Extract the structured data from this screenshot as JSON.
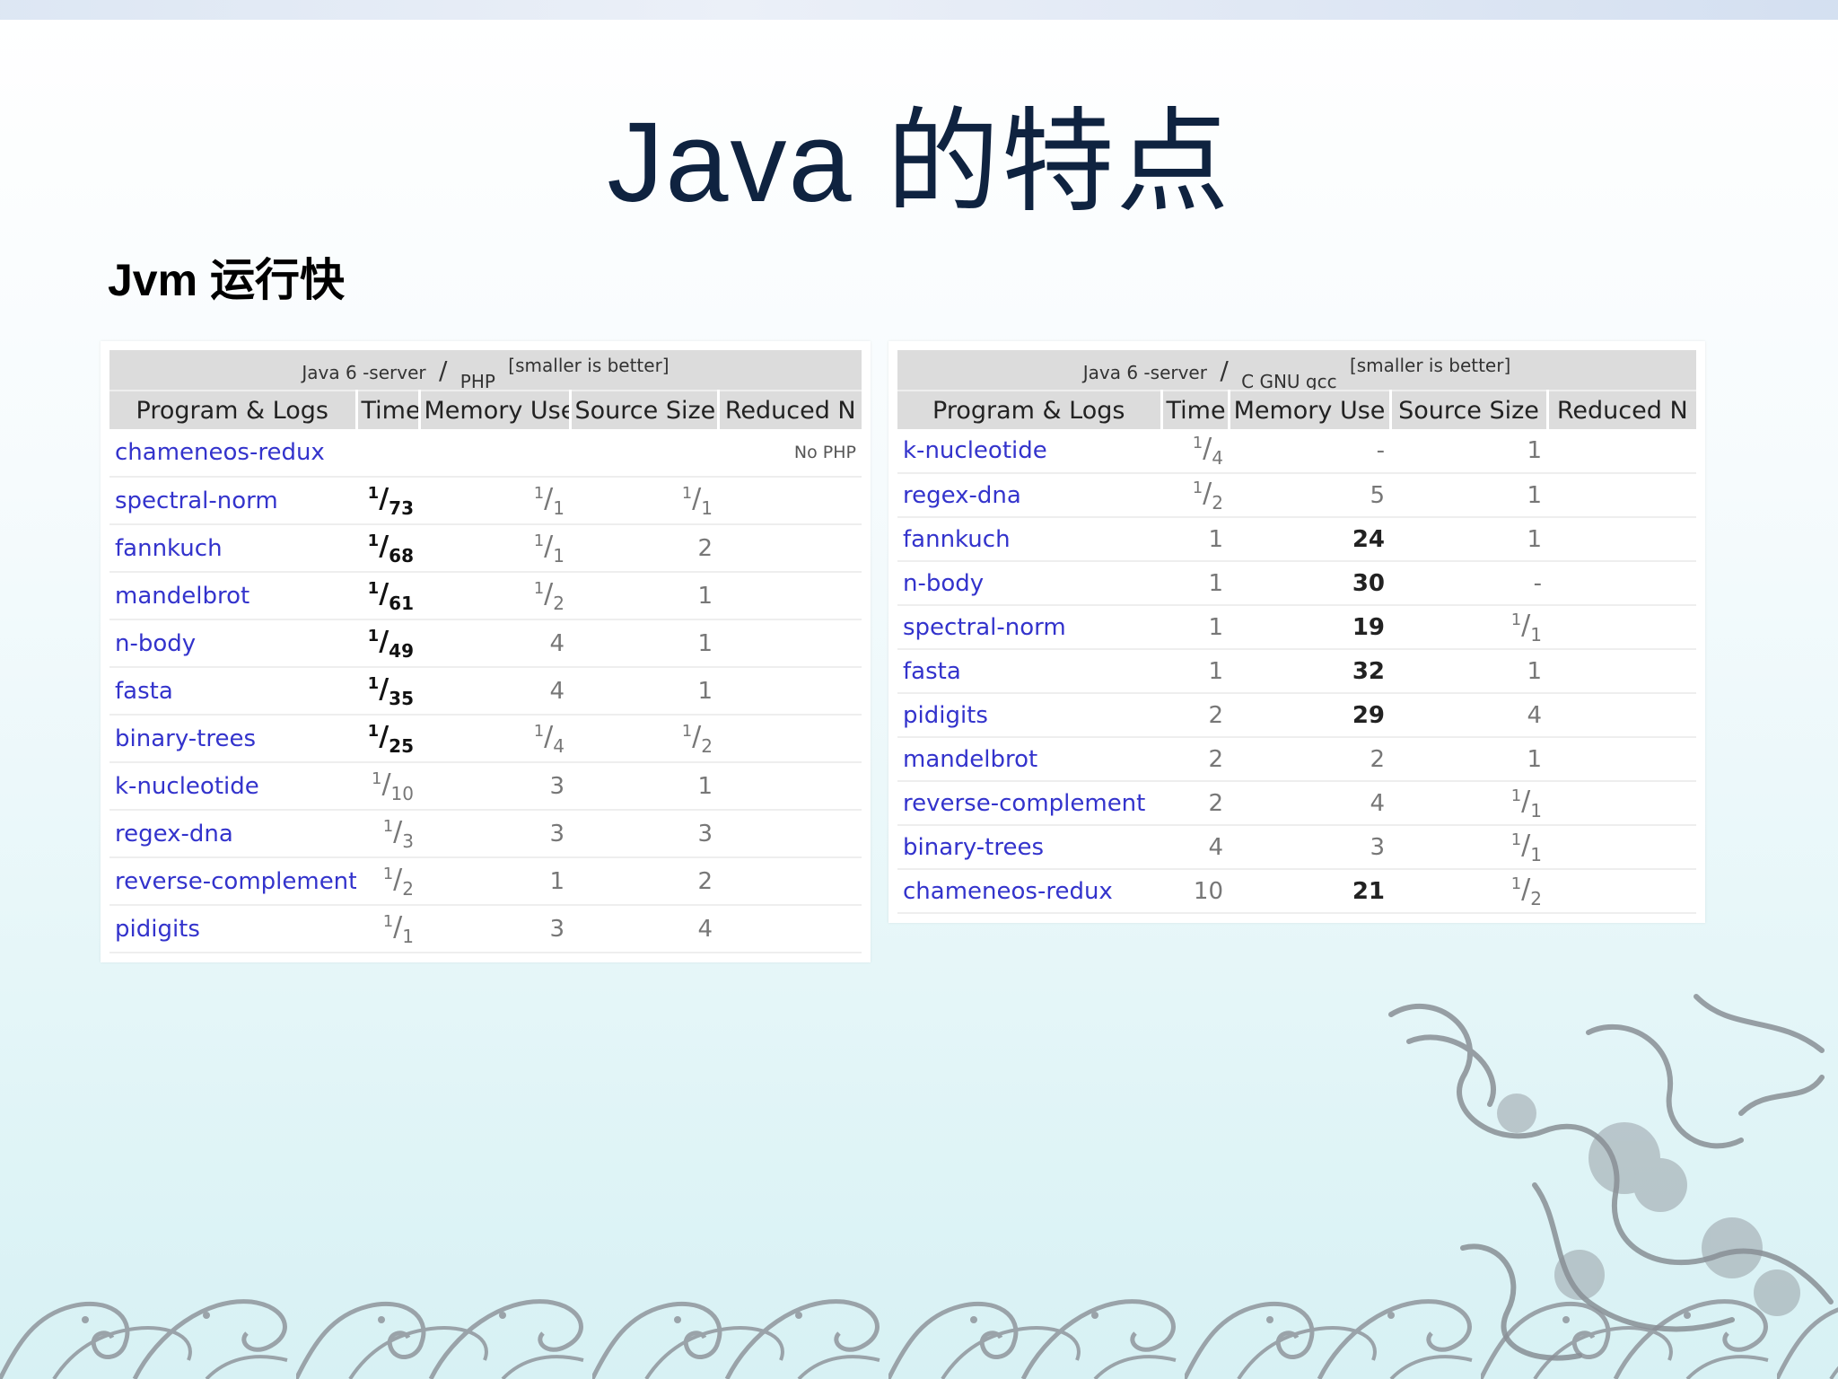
{
  "slide": {
    "title": "Java 的特点",
    "subtitle": "Jvm 运行快"
  },
  "table_left": {
    "caption": {
      "left": "Java 6 -server",
      "slash": "/",
      "right": "PHP",
      "note": "[smaller is better]"
    },
    "headers": [
      "Program & Logs",
      "Time",
      "Memory Use",
      "Source Size",
      "Reduced N"
    ],
    "rows": [
      {
        "program": "chameneos-redux",
        "note": "No PHP"
      },
      {
        "program": "spectral-norm",
        "time": {
          "num": "1",
          "den": "73",
          "bold": true
        },
        "memory": {
          "num": "1",
          "den": "1"
        },
        "source": {
          "num": "1",
          "den": "1"
        }
      },
      {
        "program": "fannkuch",
        "time": {
          "num": "1",
          "den": "68",
          "bold": true
        },
        "memory": {
          "num": "1",
          "den": "1"
        },
        "source": "2"
      },
      {
        "program": "mandelbrot",
        "time": {
          "num": "1",
          "den": "61",
          "bold": true
        },
        "memory": {
          "num": "1",
          "den": "2"
        },
        "source": "1"
      },
      {
        "program": "n-body",
        "time": {
          "num": "1",
          "den": "49",
          "bold": true
        },
        "memory": "4",
        "source": "1"
      },
      {
        "program": "fasta",
        "time": {
          "num": "1",
          "den": "35",
          "bold": true
        },
        "memory": "4",
        "source": "1"
      },
      {
        "program": "binary-trees",
        "time": {
          "num": "1",
          "den": "25",
          "bold": true
        },
        "memory": {
          "num": "1",
          "den": "4"
        },
        "source": {
          "num": "1",
          "den": "2"
        }
      },
      {
        "program": "k-nucleotide",
        "time": {
          "num": "1",
          "den": "10"
        },
        "memory": "3",
        "source": "1"
      },
      {
        "program": "regex-dna",
        "time": {
          "num": "1",
          "den": "3"
        },
        "memory": "3",
        "source": "3"
      },
      {
        "program": "reverse-complement",
        "time": {
          "num": "1",
          "den": "2"
        },
        "memory": "1",
        "source": "2"
      },
      {
        "program": "pidigits",
        "time": {
          "num": "1",
          "den": "1"
        },
        "memory": "3",
        "source": "4"
      }
    ]
  },
  "table_right": {
    "caption": {
      "left": "Java 6 -server",
      "slash": "/",
      "right": "C GNU gcc",
      "note": "[smaller is better]"
    },
    "headers": [
      "Program & Logs",
      "Time",
      "Memory Use",
      "Source Size",
      "Reduced N"
    ],
    "rows": [
      {
        "program": "k-nucleotide",
        "time": {
          "num": "1",
          "den": "4"
        },
        "memory": "-",
        "source": "1"
      },
      {
        "program": "regex-dna",
        "time": {
          "num": "1",
          "den": "2"
        },
        "memory": "5",
        "source": "1"
      },
      {
        "program": "fannkuch",
        "time": "1",
        "memory": "24",
        "memory_bold": true,
        "source": "1"
      },
      {
        "program": "n-body",
        "time": "1",
        "memory": "30",
        "memory_bold": true,
        "source": "-"
      },
      {
        "program": "spectral-norm",
        "time": "1",
        "memory": "19",
        "memory_bold": true,
        "source": {
          "num": "1",
          "den": "1"
        }
      },
      {
        "program": "fasta",
        "time": "1",
        "memory": "32",
        "memory_bold": true,
        "source": "1"
      },
      {
        "program": "pidigits",
        "time": "2",
        "memory": "29",
        "memory_bold": true,
        "source": "4"
      },
      {
        "program": "mandelbrot",
        "time": "2",
        "memory": "2",
        "source": "1"
      },
      {
        "program": "reverse-complement",
        "time": "2",
        "memory": "4",
        "source": {
          "num": "1",
          "den": "1"
        }
      },
      {
        "program": "binary-trees",
        "time": "4",
        "memory": "3",
        "source": {
          "num": "1",
          "den": "1"
        }
      },
      {
        "program": "chameneos-redux",
        "time": "10",
        "memory": "21",
        "memory_bold": true,
        "source": {
          "num": "1",
          "den": "2"
        }
      }
    ]
  },
  "decoration": {
    "waves_icon": "ocean-waves-border",
    "dragon_icon": "chinese-dragon",
    "wave_color": "#8a8f96",
    "dragon_color": "#7d8288"
  }
}
